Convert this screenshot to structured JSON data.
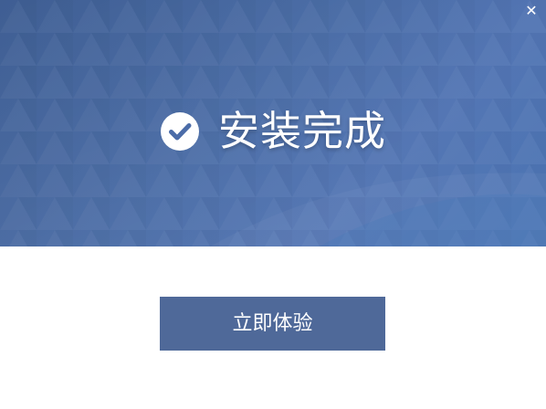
{
  "window": {
    "close_label": "✕"
  },
  "hero": {
    "title": "安装完成",
    "icon": "check-circle-icon"
  },
  "actions": {
    "primary_label": "立即体验"
  },
  "colors": {
    "hero_bg": "#4869a5",
    "button_bg": "#4f6999",
    "text": "#ffffff"
  }
}
